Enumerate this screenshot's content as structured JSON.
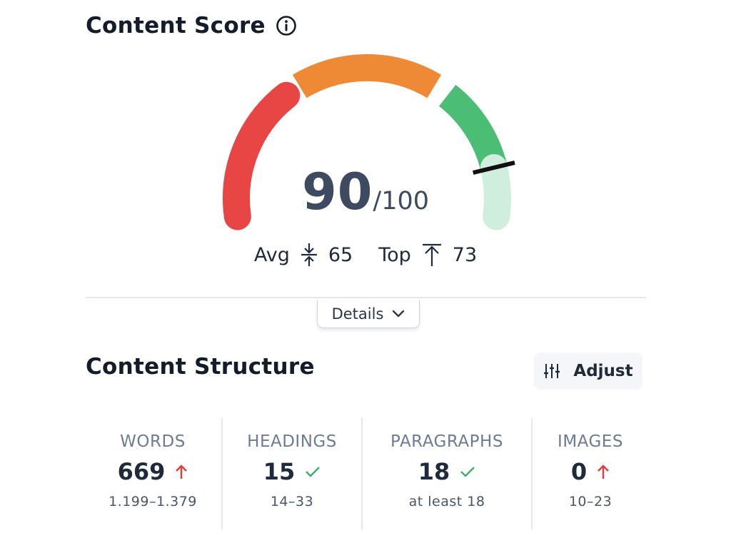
{
  "header": {
    "title": "Content Score",
    "info_icon": "info-circle-icon"
  },
  "score": {
    "value": "90",
    "max": "/100",
    "gauge_fraction": 0.9,
    "segments": [
      {
        "name": "low",
        "color": "#e84545"
      },
      {
        "name": "medium",
        "color": "#ee8a35"
      },
      {
        "name": "high",
        "color": "#4cbd74"
      },
      {
        "name": "remaining",
        "color": "#cfeedd"
      }
    ],
    "needle_color": "#111111"
  },
  "stats": {
    "avg_label": "Avg",
    "avg_value": "65",
    "avg_icon": "compress-vertical-icon",
    "top_label": "Top",
    "top_value": "73",
    "top_icon": "arrow-up-to-line-icon"
  },
  "details_button": {
    "label": "Details",
    "icon": "chevron-down-icon"
  },
  "structure": {
    "title": "Content Structure",
    "adjust_label": "Adjust",
    "adjust_icon": "sliders-icon",
    "metrics": [
      {
        "label": "WORDS",
        "value": "669",
        "status": "up",
        "range": "1.199–1.379"
      },
      {
        "label": "HEADINGS",
        "value": "15",
        "status": "ok",
        "range": "14–33"
      },
      {
        "label": "PARAGRAPHS",
        "value": "18",
        "status": "ok",
        "range": "at least 18"
      },
      {
        "label": "IMAGES",
        "value": "0",
        "status": "up",
        "range": "10–23"
      }
    ]
  },
  "colors": {
    "arrow_up": "#e03b3b",
    "check": "#3fae6a"
  }
}
